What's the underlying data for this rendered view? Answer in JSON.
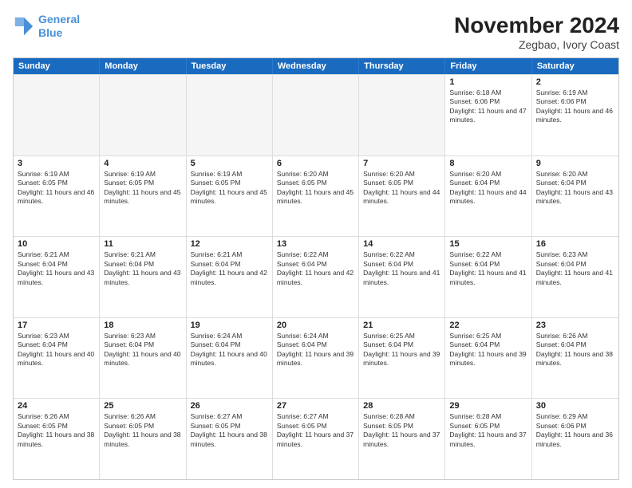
{
  "logo": {
    "line1": "General",
    "line2": "Blue",
    "icon": "▶"
  },
  "title": "November 2024",
  "subtitle": "Zegbao, Ivory Coast",
  "header_days": [
    "Sunday",
    "Monday",
    "Tuesday",
    "Wednesday",
    "Thursday",
    "Friday",
    "Saturday"
  ],
  "weeks": [
    [
      {
        "day": "",
        "empty": true
      },
      {
        "day": "",
        "empty": true
      },
      {
        "day": "",
        "empty": true
      },
      {
        "day": "",
        "empty": true
      },
      {
        "day": "",
        "empty": true
      },
      {
        "day": "1",
        "sunrise": "6:18 AM",
        "sunset": "6:06 PM",
        "daylight": "11 hours and 47 minutes."
      },
      {
        "day": "2",
        "sunrise": "6:19 AM",
        "sunset": "6:06 PM",
        "daylight": "11 hours and 46 minutes."
      }
    ],
    [
      {
        "day": "3",
        "sunrise": "6:19 AM",
        "sunset": "6:05 PM",
        "daylight": "11 hours and 46 minutes."
      },
      {
        "day": "4",
        "sunrise": "6:19 AM",
        "sunset": "6:05 PM",
        "daylight": "11 hours and 45 minutes."
      },
      {
        "day": "5",
        "sunrise": "6:19 AM",
        "sunset": "6:05 PM",
        "daylight": "11 hours and 45 minutes."
      },
      {
        "day": "6",
        "sunrise": "6:20 AM",
        "sunset": "6:05 PM",
        "daylight": "11 hours and 45 minutes."
      },
      {
        "day": "7",
        "sunrise": "6:20 AM",
        "sunset": "6:05 PM",
        "daylight": "11 hours and 44 minutes."
      },
      {
        "day": "8",
        "sunrise": "6:20 AM",
        "sunset": "6:04 PM",
        "daylight": "11 hours and 44 minutes."
      },
      {
        "day": "9",
        "sunrise": "6:20 AM",
        "sunset": "6:04 PM",
        "daylight": "11 hours and 43 minutes."
      }
    ],
    [
      {
        "day": "10",
        "sunrise": "6:21 AM",
        "sunset": "6:04 PM",
        "daylight": "11 hours and 43 minutes."
      },
      {
        "day": "11",
        "sunrise": "6:21 AM",
        "sunset": "6:04 PM",
        "daylight": "11 hours and 43 minutes."
      },
      {
        "day": "12",
        "sunrise": "6:21 AM",
        "sunset": "6:04 PM",
        "daylight": "11 hours and 42 minutes."
      },
      {
        "day": "13",
        "sunrise": "6:22 AM",
        "sunset": "6:04 PM",
        "daylight": "11 hours and 42 minutes."
      },
      {
        "day": "14",
        "sunrise": "6:22 AM",
        "sunset": "6:04 PM",
        "daylight": "11 hours and 41 minutes."
      },
      {
        "day": "15",
        "sunrise": "6:22 AM",
        "sunset": "6:04 PM",
        "daylight": "11 hours and 41 minutes."
      },
      {
        "day": "16",
        "sunrise": "6:23 AM",
        "sunset": "6:04 PM",
        "daylight": "11 hours and 41 minutes."
      }
    ],
    [
      {
        "day": "17",
        "sunrise": "6:23 AM",
        "sunset": "6:04 PM",
        "daylight": "11 hours and 40 minutes."
      },
      {
        "day": "18",
        "sunrise": "6:23 AM",
        "sunset": "6:04 PM",
        "daylight": "11 hours and 40 minutes."
      },
      {
        "day": "19",
        "sunrise": "6:24 AM",
        "sunset": "6:04 PM",
        "daylight": "11 hours and 40 minutes."
      },
      {
        "day": "20",
        "sunrise": "6:24 AM",
        "sunset": "6:04 PM",
        "daylight": "11 hours and 39 minutes."
      },
      {
        "day": "21",
        "sunrise": "6:25 AM",
        "sunset": "6:04 PM",
        "daylight": "11 hours and 39 minutes."
      },
      {
        "day": "22",
        "sunrise": "6:25 AM",
        "sunset": "6:04 PM",
        "daylight": "11 hours and 39 minutes."
      },
      {
        "day": "23",
        "sunrise": "6:26 AM",
        "sunset": "6:04 PM",
        "daylight": "11 hours and 38 minutes."
      }
    ],
    [
      {
        "day": "24",
        "sunrise": "6:26 AM",
        "sunset": "6:05 PM",
        "daylight": "11 hours and 38 minutes."
      },
      {
        "day": "25",
        "sunrise": "6:26 AM",
        "sunset": "6:05 PM",
        "daylight": "11 hours and 38 minutes."
      },
      {
        "day": "26",
        "sunrise": "6:27 AM",
        "sunset": "6:05 PM",
        "daylight": "11 hours and 38 minutes."
      },
      {
        "day": "27",
        "sunrise": "6:27 AM",
        "sunset": "6:05 PM",
        "daylight": "11 hours and 37 minutes."
      },
      {
        "day": "28",
        "sunrise": "6:28 AM",
        "sunset": "6:05 PM",
        "daylight": "11 hours and 37 minutes."
      },
      {
        "day": "29",
        "sunrise": "6:28 AM",
        "sunset": "6:05 PM",
        "daylight": "11 hours and 37 minutes."
      },
      {
        "day": "30",
        "sunrise": "6:29 AM",
        "sunset": "6:06 PM",
        "daylight": "11 hours and 36 minutes."
      }
    ]
  ]
}
